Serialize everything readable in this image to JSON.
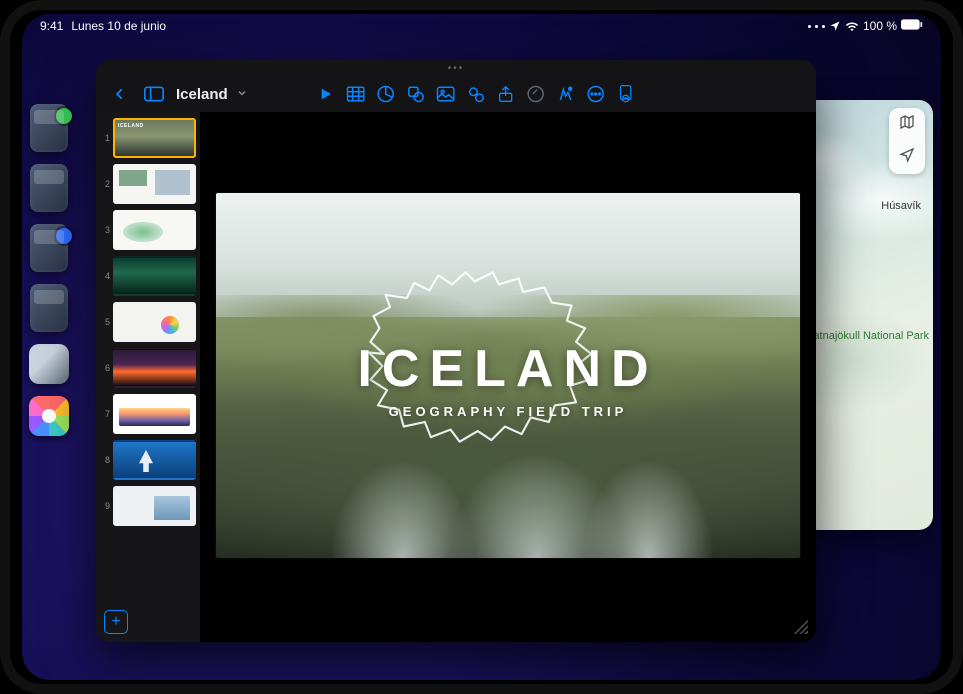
{
  "statusBar": {
    "time": "9:41",
    "date": "Lunes 10 de junio",
    "battery": "100 %"
  },
  "shelf": {
    "apps": [
      "stage-stack-1",
      "stage-stack-2",
      "stage-stack-3",
      "stage-stack-4",
      "photo-app",
      "photos-app"
    ]
  },
  "maps": {
    "labels": {
      "husavik": "Húsavík",
      "park": "Vatnajökull National Park"
    },
    "controls": {
      "mode": "map-mode-icon",
      "locate": "location-icon"
    }
  },
  "keynote": {
    "documentTitle": "Iceland",
    "addSlideGlyph": "+",
    "toolbarIcons": [
      "back",
      "sidebar",
      "play",
      "table",
      "chart",
      "shape",
      "image",
      "media",
      "share",
      "record",
      "animate",
      "more",
      "document"
    ],
    "slides": [
      {
        "n": "1",
        "kind": "iceland",
        "label": "ICELAND",
        "selected": true
      },
      {
        "n": "2",
        "kind": "collage"
      },
      {
        "n": "3",
        "kind": "white"
      },
      {
        "n": "4",
        "kind": "aurora"
      },
      {
        "n": "5",
        "kind": "infographic"
      },
      {
        "n": "6",
        "kind": "volcano"
      },
      {
        "n": "7",
        "kind": "mountains"
      },
      {
        "n": "8",
        "kind": "blue"
      },
      {
        "n": "9",
        "kind": "last"
      }
    ],
    "currentSlide": {
      "title": "ICELAND",
      "subtitle": "GEOGRAPHY FIELD TRIP"
    }
  }
}
